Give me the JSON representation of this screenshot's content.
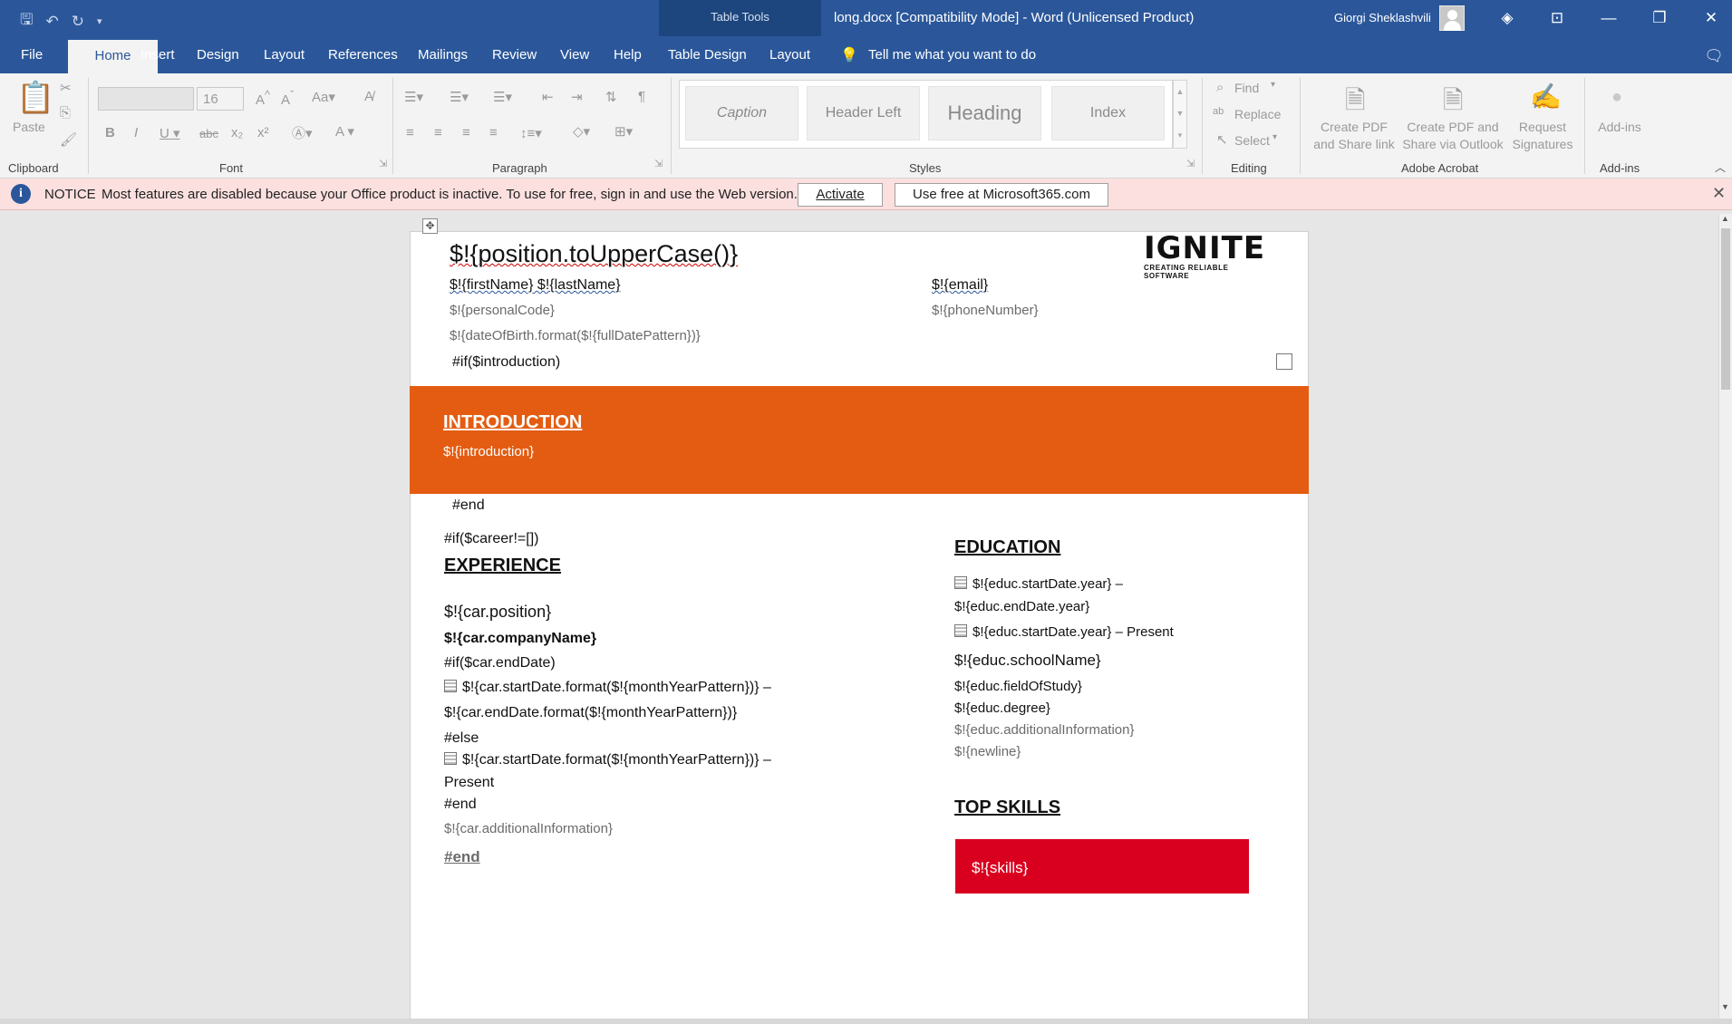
{
  "titlebar": {
    "table_tools": "Table Tools",
    "document_title": "long.docx [Compatibility Mode]  -  Word (Unlicensed Product)",
    "user_name": "Giorgi Sheklashvili"
  },
  "ribbon_tabs": [
    "File",
    "Home",
    "Insert",
    "Design",
    "Layout",
    "References",
    "Mailings",
    "Review",
    "View",
    "Help",
    "Table Design",
    "Layout"
  ],
  "tell_me": "Tell me what you want to do",
  "ribbon": {
    "clipboard": {
      "paste": "Paste",
      "label": "Clipboard"
    },
    "font": {
      "font_name": "",
      "font_size": "16",
      "label": "Font"
    },
    "paragraph": {
      "label": "Paragraph"
    },
    "styles": {
      "label": "Styles",
      "items": [
        "Caption",
        "Header Left",
        "Heading",
        "Index"
      ]
    },
    "editing": {
      "find": "Find",
      "replace": "Replace",
      "select": "Select",
      "label": "Editing"
    },
    "acrobat": {
      "create_pdf_share": "Create PDF and Share link",
      "create_pdf_outlook": "Create PDF and Share via Outlook",
      "request_signatures": "Request Signatures",
      "label": "Adobe Acrobat"
    },
    "addins": {
      "button": "Add-ins",
      "label": "Add-ins"
    }
  },
  "notice": {
    "title": "NOTICE",
    "message": "Most features are disabled because your Office product is inactive. To use for free, sign in and use the Web version.",
    "activate": "Activate",
    "use_free": "Use free at Microsoft365.com"
  },
  "document": {
    "position": "$!{position.toUpperCase()}",
    "name": "$!{firstName} $!{lastName}",
    "email": "$!{email}",
    "personal_code": "$!{personalCode}",
    "phone": "$!{phoneNumber}",
    "dob": "$!{dateOfBirth.format($!{fullDatePattern})}",
    "if_intro": "#if($introduction)",
    "intro_heading": "INTRODUCTION",
    "intro_text": "$!{introduction}",
    "end1": "#end",
    "if_career": "#if($career!=[])",
    "experience_heading": "EXPERIENCE",
    "car_position": "$!{car.position}",
    "car_company": "$!{car.companyName}",
    "if_end_date": "#if($car.endDate)",
    "car_start_1": "$!{car.startDate.format($!{monthYearPattern})} –",
    "car_end": "$!{car.endDate.format($!{monthYearPattern})}",
    "else": "#else",
    "car_start_2": "$!{car.startDate.format($!{monthYearPattern})} –",
    "present": "Present",
    "end2": "#end",
    "car_info": "$!{car.additionalInformation}",
    "end3": "#end",
    "education_heading": "EDUCATION",
    "educ_start_1": "$!{educ.startDate.year} –",
    "educ_end": "$!{educ.endDate.year}",
    "educ_start_2": "$!{educ.startDate.year} – Present",
    "educ_school": "$!{educ.schoolName}",
    "educ_field": "$!{educ.fieldOfStudy}",
    "educ_degree": "$!{educ.degree}",
    "educ_info": "$!{educ.additionalInformation}",
    "newline": "$!{newline}",
    "skills_heading": "TOP SKILLS",
    "skills": "$!{skills}"
  },
  "logo": {
    "word": "IGNITE",
    "tagline": "CREATING RELIABLE SOFTWARE"
  },
  "colors": {
    "word_blue": "#2b579a",
    "intro_orange": "#e35c11",
    "skills_red": "#d9001f",
    "notice_pink": "#fbe0df"
  }
}
